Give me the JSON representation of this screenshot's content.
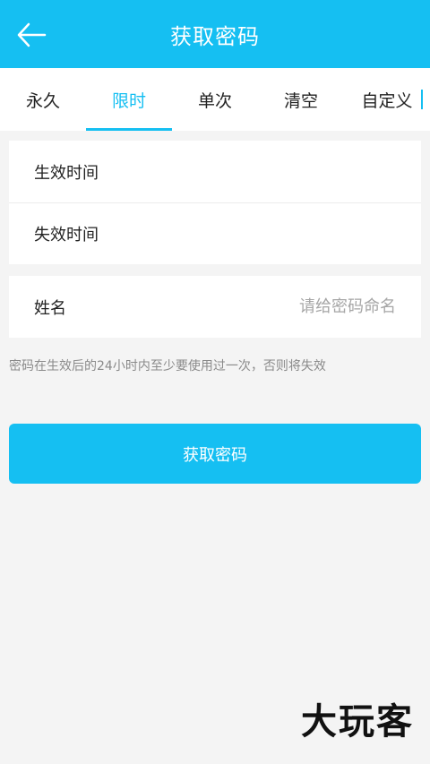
{
  "header": {
    "title": "获取密码",
    "back_icon": "arrow-left-icon"
  },
  "tabs": [
    {
      "label": "永久",
      "active": false
    },
    {
      "label": "限时",
      "active": true
    },
    {
      "label": "单次",
      "active": false
    },
    {
      "label": "清空",
      "active": false
    },
    {
      "label": "自定义",
      "active": false
    }
  ],
  "time_card": {
    "start_label": "生效时间",
    "start_value": "",
    "end_label": "失效时间",
    "end_value": ""
  },
  "name_card": {
    "label": "姓名",
    "value": "",
    "placeholder": "请给密码命名"
  },
  "note": "密码在生效后的24小时内至少要使用过一次，否则将失效",
  "button": {
    "label": "获取密码"
  },
  "watermark": "大玩客",
  "colors": {
    "accent": "#15bff2",
    "background": "#f4f4f4"
  }
}
